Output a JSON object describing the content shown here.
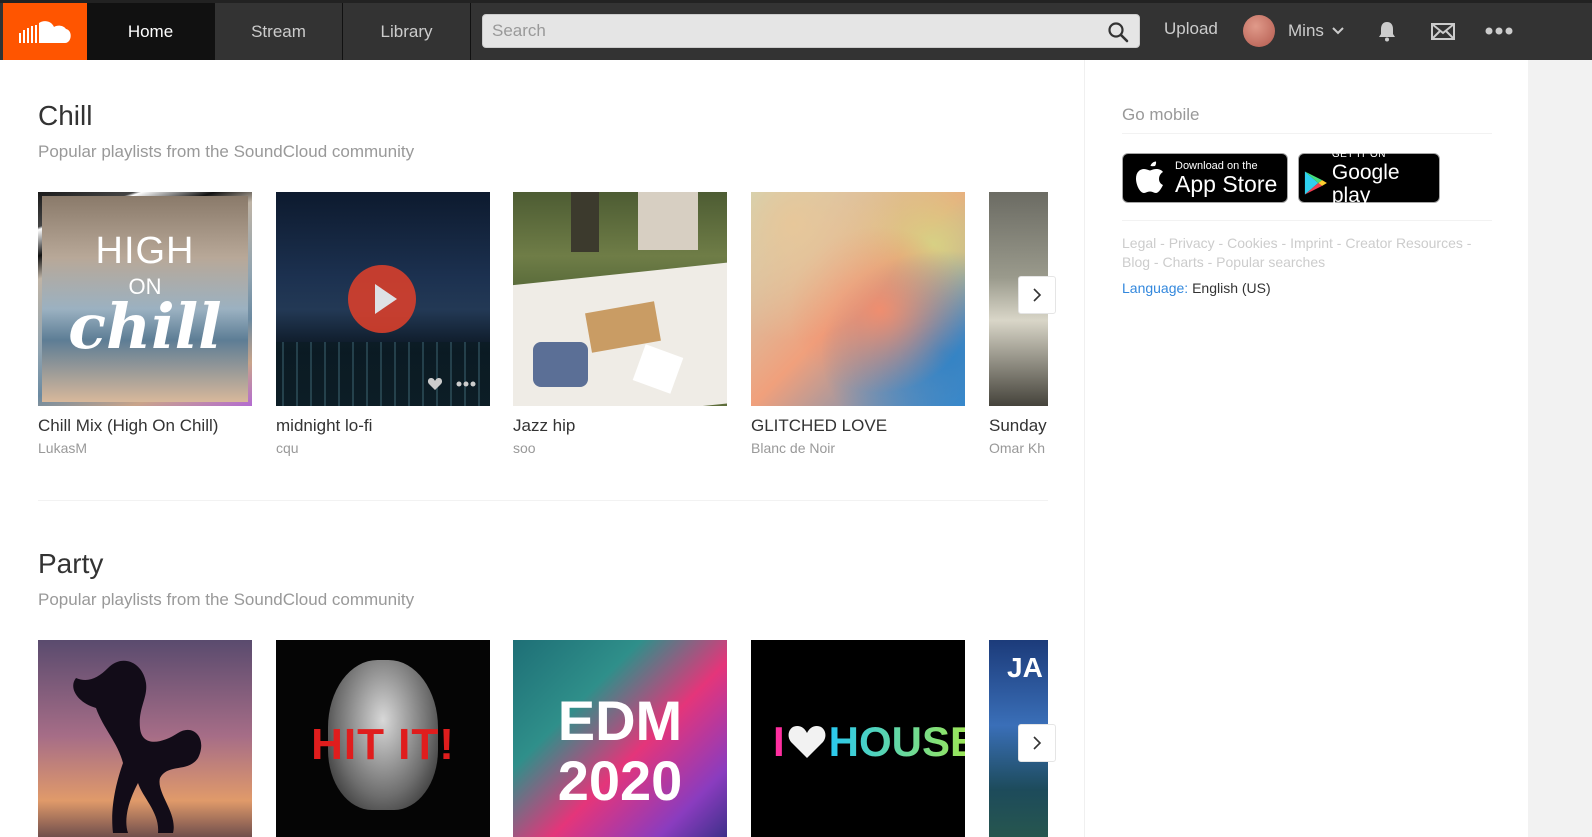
{
  "header": {
    "logo_icon": "soundcloud-logo-icon",
    "tabs": [
      {
        "label": "Home",
        "active": true
      },
      {
        "label": "Stream",
        "active": false
      },
      {
        "label": "Library",
        "active": false
      }
    ],
    "search": {
      "placeholder": "Search",
      "value": ""
    },
    "upload_label": "Upload",
    "username": "Mins",
    "icons": [
      "bell-icon",
      "mail-icon",
      "more-icon"
    ]
  },
  "sections": [
    {
      "title": "Chill",
      "subtitle": "Popular playlists from the SoundCloud community",
      "cards": [
        {
          "title": "Chill Mix (High On Chill)",
          "user": "LukasM",
          "art_text": [
            "HIGH",
            "ON",
            "chill"
          ]
        },
        {
          "title": "midnight lo-fi",
          "user": "cqu"
        },
        {
          "title": "Jazz hip",
          "user": "soo"
        },
        {
          "title": "GLITCHED LOVE",
          "user": "Blanc de Noir"
        },
        {
          "title": "Sunday",
          "user": "Omar Kh"
        }
      ]
    },
    {
      "title": "Party",
      "subtitle": "Popular playlists from the SoundCloud community",
      "cards": [
        {
          "art_text": []
        },
        {
          "art_text": [
            "HIT IT!"
          ]
        },
        {
          "art_text": [
            "EDM",
            "2020"
          ]
        },
        {
          "art_text": [
            "I",
            "HOUSE"
          ]
        },
        {
          "art_text": [
            "JA"
          ]
        }
      ]
    }
  ],
  "sidebar": {
    "go_mobile": "Go mobile",
    "app_store": {
      "small": "Download on the",
      "big": "App Store"
    },
    "google_play": {
      "small": "GET IT ON",
      "big": "Google play"
    },
    "legal_links": [
      "Legal",
      "Privacy",
      "Cookies",
      "Imprint",
      "Creator Resources",
      "Blog",
      "Charts",
      "Popular searches"
    ],
    "language_label": "Language:",
    "language_value": "English (US)"
  },
  "colors": {
    "brand": "#ff5500",
    "header": "#333333",
    "link": "#3388dd"
  }
}
